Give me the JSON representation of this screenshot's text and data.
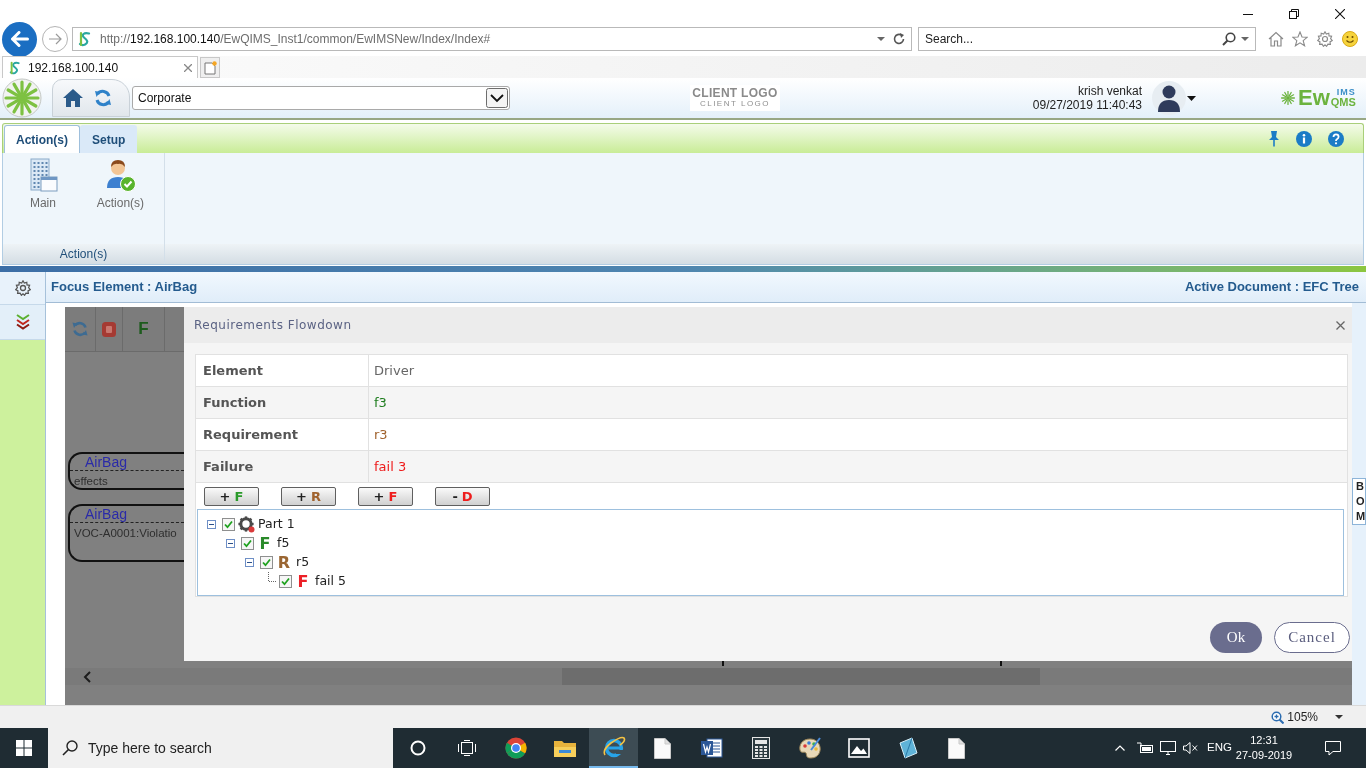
{
  "browser": {
    "url": {
      "scheme": "http://",
      "host": "192.168.100.140",
      "path": "/EwQIMS_Inst1/common/EwIMSNew/Index/Index#"
    },
    "search": {
      "placeholder": "Search..."
    },
    "tabs": [
      {
        "label": "192.168.100.140",
        "selected": true
      }
    ],
    "zoom": "105%"
  },
  "header": {
    "company": "Corporate",
    "client_logo": {
      "title": "CLIENT LOGO",
      "subtitle": "CLIENT LOGO"
    },
    "user": {
      "name": "krish venkat",
      "datetime": "09/27/2019 11:40:43"
    },
    "brand": {
      "main": "Ew",
      "sup": "IMS",
      "sub": "QMS"
    }
  },
  "ribbon": {
    "tabs": [
      {
        "label": "Action(s)",
        "selected": true
      },
      {
        "label": "Setup",
        "selected": false
      }
    ],
    "groups": [
      {
        "label": "Action(s)",
        "items": [
          {
            "kind": "main",
            "label": "Main"
          },
          {
            "kind": "actions",
            "label": "Action(s)"
          }
        ]
      }
    ]
  },
  "focus_bar": {
    "focus": "Focus Element : AirBag",
    "active_document": "Active Document : EFC Tree"
  },
  "canvas": {
    "toolbar": [
      {
        "kind": "refresh"
      },
      {
        "kind": "stop"
      },
      {
        "kind": "letter",
        "label": "F"
      }
    ],
    "nodes": [
      {
        "title": "AirBag",
        "text": "effects"
      },
      {
        "title": "AirBag",
        "text": "VOC-A0001:Violatio"
      }
    ],
    "side_tab": "BOM"
  },
  "dialog": {
    "title": "Requirements Flowdown",
    "fields": [
      {
        "label": "Element",
        "value": "Driver",
        "color": "#666666"
      },
      {
        "label": "Function",
        "value": "f3",
        "color": "#1e7d1e"
      },
      {
        "label": "Requirement",
        "value": "r3",
        "color": "#a0622d"
      },
      {
        "label": "Failure",
        "value": "fail 3",
        "color": "#ee1c1c"
      }
    ],
    "actions": [
      {
        "sign": "+",
        "letter": "F",
        "kind": "function"
      },
      {
        "sign": "+",
        "letter": "R",
        "kind": "requirement"
      },
      {
        "sign": "+",
        "letter": "F",
        "kind": "failure"
      },
      {
        "sign": "-",
        "letter": "D",
        "kind": "delete"
      }
    ],
    "tree": [
      {
        "label": "Part 1",
        "kind": "part",
        "checked": true,
        "expanded": true,
        "children": [
          {
            "label": "f5",
            "kind": "function",
            "badge": "F",
            "checked": true,
            "expanded": true,
            "children": [
              {
                "label": "r5",
                "kind": "requirement",
                "badge": "R",
                "checked": true,
                "expanded": true,
                "children": [
                  {
                    "label": "fail 5",
                    "kind": "failure",
                    "badge": "F",
                    "checked": true
                  }
                ]
              }
            ]
          }
        ]
      }
    ],
    "buttons": [
      {
        "label": "Ok",
        "kind": "primary"
      },
      {
        "label": "Cancel",
        "kind": "secondary"
      }
    ]
  },
  "taskbar": {
    "search": {
      "placeholder": "Type here to search"
    },
    "apps": [
      {
        "kind": "cortana",
        "selected": false
      },
      {
        "kind": "task-view",
        "selected": false
      },
      {
        "kind": "chrome",
        "selected": false
      },
      {
        "kind": "explorer",
        "selected": false
      },
      {
        "kind": "ie",
        "selected": true
      },
      {
        "kind": "document",
        "selected": false
      },
      {
        "kind": "word",
        "selected": false
      },
      {
        "kind": "calculator",
        "selected": false
      },
      {
        "kind": "paint",
        "selected": false
      },
      {
        "kind": "photos",
        "selected": false
      },
      {
        "kind": "prism",
        "selected": false
      },
      {
        "kind": "document",
        "selected": false
      }
    ],
    "tray": {
      "language": "ENG",
      "time": "12:31",
      "date": "27-09-2019"
    }
  }
}
